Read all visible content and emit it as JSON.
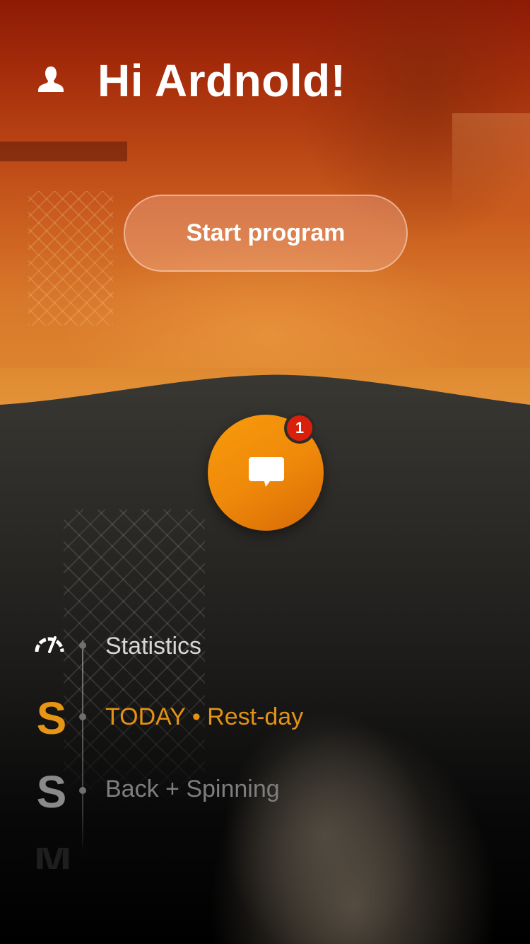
{
  "header": {
    "greeting": "Hi Ardnold!",
    "avatar_icon": "user-silhouette-icon"
  },
  "hero": {
    "start_button_label": "Start program"
  },
  "chat": {
    "icon": "speech-bubble-icon",
    "badge_count": "1"
  },
  "timeline": {
    "items": [
      {
        "icon": "speedometer-icon",
        "label": "Statistics"
      },
      {
        "day_letter": "S",
        "label": "TODAY • Rest-day"
      },
      {
        "day_letter": "S",
        "label": "Back + Spinning"
      },
      {
        "day_letter": "M",
        "label": ""
      }
    ]
  },
  "colors": {
    "accent_orange": "#f08a0a",
    "today_text": "#e39214",
    "badge_red": "#d8200c",
    "hero_top": "#8e1a06",
    "hero_bottom": "#e08d32"
  }
}
